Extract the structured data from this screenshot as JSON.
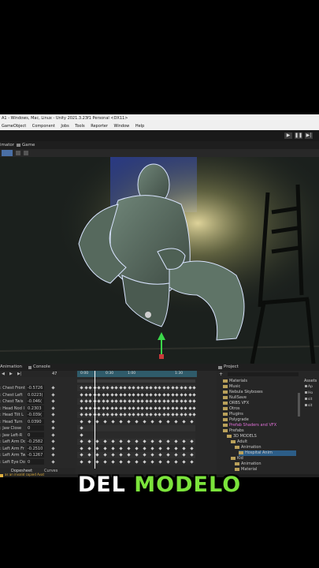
{
  "window": {
    "title": "A1 - Windows, Mac, Linux - Unity 2021.3.23f1 Personal <DX11>"
  },
  "menu": {
    "items": [
      "GameObject",
      "Component",
      "Jobs",
      "Tools",
      "Reporter",
      "Window",
      "Help"
    ]
  },
  "tabs": {
    "animator": "imator",
    "game": "Game"
  },
  "panels": {
    "animation_tab": "Animation",
    "console_tab": "Console",
    "project_tab": "Project",
    "frame_value": "47",
    "dopesheet_tab": "Dopesheet",
    "curves_tab": "Curves",
    "timeline_marks": [
      "0:00",
      "0:30",
      "1:00",
      "1:30"
    ],
    "assets_label": "Assets"
  },
  "properties": [
    {
      "name": ": Chest Front",
      "value": "-0.5726"
    },
    {
      "name": ": Chest Left",
      "value": "0.0223("
    },
    {
      "name": ": Chest Twis",
      "value": "-0.046("
    },
    {
      "name": ": Head Nod I",
      "value": "0.2303"
    },
    {
      "name": ": Head Tilt L",
      "value": "-0.039("
    },
    {
      "name": ": Head Turn",
      "value": "0.0390"
    },
    {
      "name": ": Jaw Close",
      "value": "0"
    },
    {
      "name": ": Jaw Left-R",
      "value": "0"
    },
    {
      "name": ": Left Arm Do",
      "value": "-0.2582"
    },
    {
      "name": ": Left Arm Fr",
      "value": "-0.2510"
    },
    {
      "name": ": Left Arm Tw",
      "value": "-0.1267"
    },
    {
      "name": ": Left Eye Do",
      "value": "0"
    }
  ],
  "project_tree": [
    {
      "label": "Materials",
      "indent": 0
    },
    {
      "label": "Music",
      "indent": 0
    },
    {
      "label": "Nebula Skyboxes",
      "indent": 0
    },
    {
      "label": "NullSave",
      "indent": 0
    },
    {
      "label": "ORBS VFX",
      "indent": 0
    },
    {
      "label": "Otros",
      "indent": 0
    },
    {
      "label": "Plugins",
      "indent": 0
    },
    {
      "label": "Polygrade",
      "indent": 0
    },
    {
      "label": "Prefab Shaders and VFX",
      "indent": 0
    },
    {
      "label": "Prefabs",
      "indent": 0
    },
    {
      "label": "3D MODELS",
      "indent": 1
    },
    {
      "label": "Adult",
      "indent": 2
    },
    {
      "label": "Animation",
      "indent": 3
    },
    {
      "label": "Hospital Anim",
      "indent": 4
    },
    {
      "label": "Kid",
      "indent": 2
    },
    {
      "label": "Animation",
      "indent": 3
    },
    {
      "label": "Material",
      "indent": 3
    }
  ],
  "assets_side": [
    "Ap",
    "Ho",
    "sit",
    "sit"
  ],
  "status": {
    "warning": "as an invalid copied Avat"
  },
  "caption": {
    "word1": "DEL",
    "word2": "MODELO"
  },
  "colors": {
    "caption_white": "#ffffff",
    "caption_green": "#7be33b",
    "selection_blue": "#2c5d87",
    "gizmo_green": "#3bd64a"
  }
}
